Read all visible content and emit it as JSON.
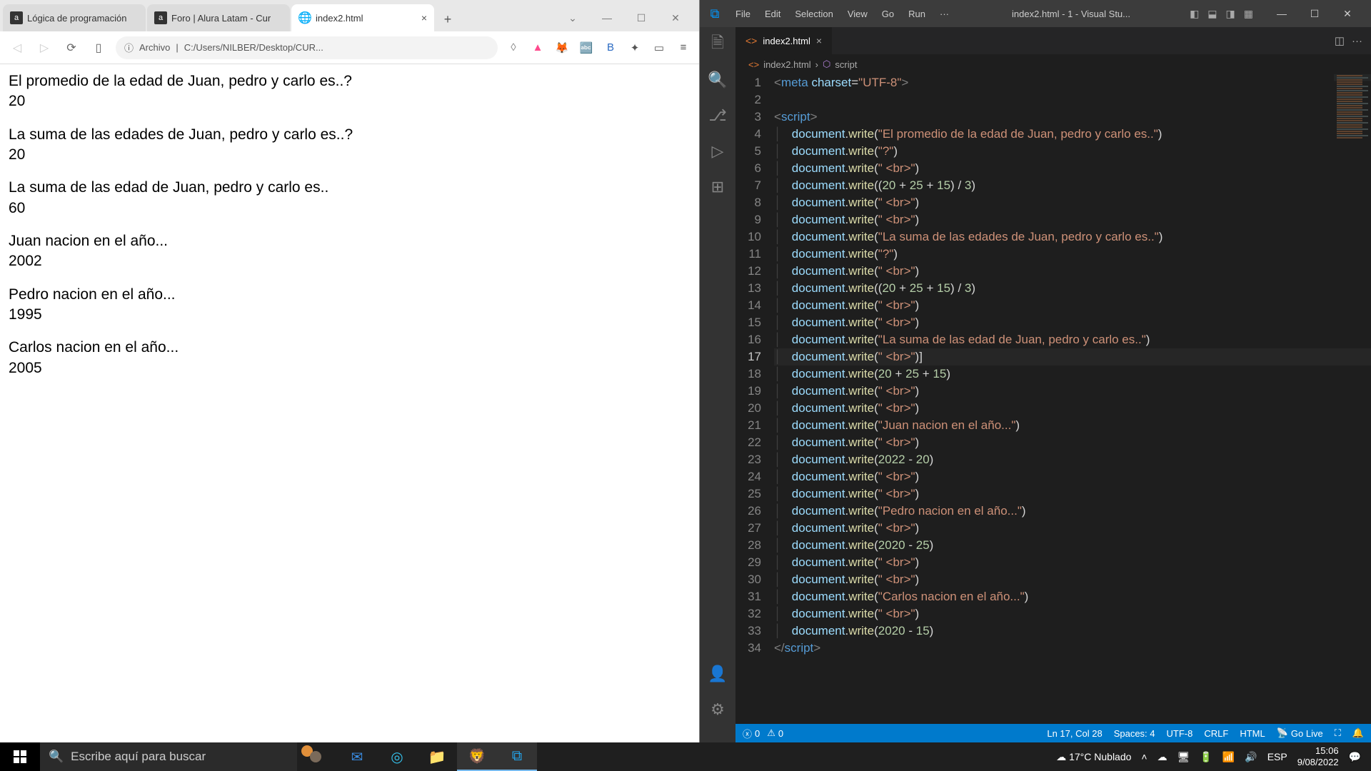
{
  "browser": {
    "tabs": [
      {
        "label": "Lógica de programación",
        "active": false
      },
      {
        "label": "Foro | Alura Latam - Cur",
        "active": false
      },
      {
        "label": "index2.html",
        "active": true
      }
    ],
    "address_prefix": "Archivo",
    "address": "C:/Users/NILBER/Desktop/CUR...",
    "page": {
      "l1": "El promedio de la edad de Juan, pedro y carlo es..?",
      "v1": "20",
      "l2": "La suma de las edades de Juan, pedro y carlo es..?",
      "v2": "20",
      "l3": "La suma de las edad de Juan, pedro y carlo es..",
      "v3": "60",
      "l4": "Juan nacion en el año...",
      "v4": "2002",
      "l5": "Pedro nacion en el año...",
      "v5": "1995",
      "l6": "Carlos nacion en el año...",
      "v6": "2005"
    }
  },
  "vscode": {
    "menu": [
      "File",
      "Edit",
      "Selection",
      "View",
      "Go",
      "Run",
      "···"
    ],
    "title": "index2.html - 1 - Visual Stu...",
    "tab": "index2.html",
    "breadcrumb": {
      "file": "index2.html",
      "sym": "script"
    },
    "status": {
      "errors": "0",
      "warnings": "0",
      "lncol": "Ln 17, Col 28",
      "spaces": "Spaces: 4",
      "enc": "UTF-8",
      "eol": "CRLF",
      "lang": "HTML",
      "golive": "Go Live"
    },
    "code": {
      "s_promedio": "\"El promedio de la edad de Juan, pedro y carlo es..\"",
      "s_q": "\"?\"",
      "s_br": "\" <br>\"",
      "s_sumae": "\"La suma de las edades de Juan, pedro y carlo es..\"",
      "s_sumad": "\"La suma de las edad de Juan, pedro y carlo es..\"",
      "s_juan": "\"Juan nacion en el año...\"",
      "s_pedro": "\"Pedro nacion en el año...\"",
      "s_carlos": "\"Carlos nacion en el año...\"",
      "s_utf": "\"UTF-8\""
    }
  },
  "taskbar": {
    "search_placeholder": "Escribe aquí para buscar",
    "weather": "17°C  Nublado",
    "lang": "ESP",
    "time": "15:06",
    "date": "9/08/2022"
  }
}
